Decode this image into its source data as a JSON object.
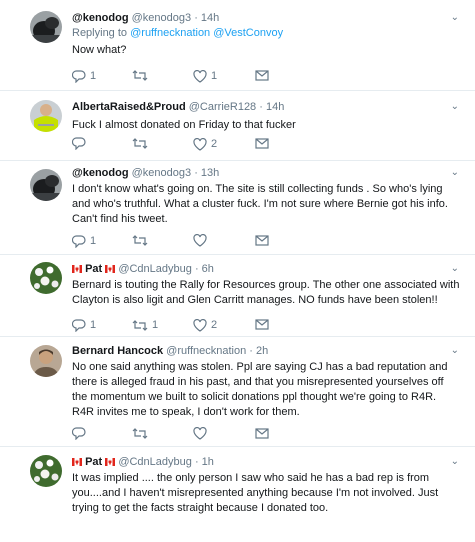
{
  "tweets": [
    {
      "name": "@kenodog",
      "handle": "@kenodog3",
      "time": "14h",
      "reply_prefix": "Replying to",
      "reply_to": "@ruffnecknation @VestConvoy",
      "text": "Now what?",
      "reply_count": "1",
      "retweet_count": "",
      "like_count": "1",
      "avatar": "dark-dog-icon"
    },
    {
      "name": "AlbertaRaised&Proud",
      "handle": "@CarrieR128",
      "time": "14h",
      "text": "Fuck I almost donated on Friday to that fucker",
      "reply_count": "",
      "retweet_count": "",
      "like_count": "2",
      "avatar": "safety-vest-icon"
    },
    {
      "name": "@kenodog",
      "handle": "@kenodog3",
      "time": "13h",
      "text": "I don't know what's going on. The site is still collecting funds . So who's lying and who's truthful.  What a cluster fuck.  I'm not sure where Bernie got his info. Can't find his tweet.",
      "reply_count": "1",
      "retweet_count": "",
      "like_count": "",
      "avatar": "dark-dog-icon"
    },
    {
      "name": "Pat",
      "handle": "@CdnLadybug",
      "time": "6h",
      "text": "Bernard is touting the Rally for Resources group. The other one associated with Clayton is also ligit and Glen Carritt manages. NO funds have been stolen!!",
      "reply_count": "1",
      "retweet_count": "1",
      "like_count": "2",
      "avatar": "white-flowers-icon"
    },
    {
      "name": "Bernard Hancock",
      "handle": "@ruffnecknation",
      "time": "2h",
      "text_lines": [
        "No one said anything was stolen. Ppl are saying CJ has a bad reputation and there is alleged fraud in his past, and that you misrepresented yourselves off the momentum we built to solicit donations ppl thought we're going to R4R.",
        "R4R invites me to speak, I don't work for them."
      ],
      "reply_count": "",
      "retweet_count": "",
      "like_count": "",
      "avatar": "man-portrait-icon"
    },
    {
      "name": "Pat",
      "handle": "@CdnLadybug",
      "time": "1h",
      "text": "It was implied .... the only person I saw who said he has a bad rep is from you....and I haven't misrepresented anything because I'm not involved. Just trying to get the facts straight because I donated too.",
      "avatar": "white-flowers-icon"
    }
  ],
  "ui": {
    "dot": "·"
  },
  "colors": {
    "text": "#14171a",
    "muted": "#657786",
    "link": "#1da1f2",
    "border": "#e6ecf0",
    "flag_red": "#e1251b"
  }
}
